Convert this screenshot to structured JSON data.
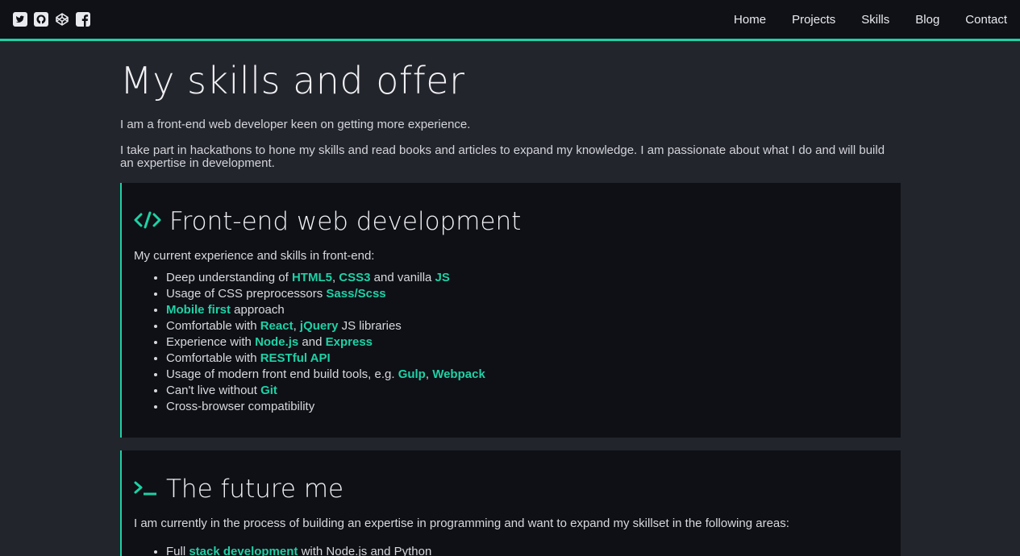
{
  "nav": {
    "social": [
      {
        "name": "twitter-icon"
      },
      {
        "name": "github-icon"
      },
      {
        "name": "codepen-icon"
      },
      {
        "name": "facebook-icon"
      }
    ],
    "links": [
      "Home",
      "Projects",
      "Skills",
      "Blog",
      "Contact"
    ]
  },
  "colors": {
    "accent": "#1fd1a5",
    "background": "#23252d",
    "card": "#0e1016",
    "topbar": "#0f1117"
  },
  "page": {
    "title": "My skills and offer",
    "intro1": "I am a front-end web developer keen on getting more experience.",
    "intro2": "I take part in hackathons to hone my skills and read books and articles to expand my knowledge. I am passionate about what I do and will build an expertise in development."
  },
  "frontend": {
    "icon": "code-icon",
    "title": "Front-end web development",
    "lead": "My current experience and skills in front-end:",
    "items": [
      [
        {
          "t": "Deep understanding of "
        },
        {
          "t": "HTML5",
          "h": true
        },
        {
          "t": ", "
        },
        {
          "t": "CSS3",
          "h": true
        },
        {
          "t": " and vanilla "
        },
        {
          "t": "JS",
          "h": true
        }
      ],
      [
        {
          "t": "Usage of CSS preprocessors "
        },
        {
          "t": "Sass/Scss",
          "h": true
        }
      ],
      [
        {
          "t": "Mobile first",
          "h": true
        },
        {
          "t": " approach"
        }
      ],
      [
        {
          "t": "Comfortable with "
        },
        {
          "t": "React",
          "h": true
        },
        {
          "t": ", "
        },
        {
          "t": "jQuery",
          "h": true
        },
        {
          "t": " JS libraries"
        }
      ],
      [
        {
          "t": "Experience with "
        },
        {
          "t": "Node.js",
          "h": true
        },
        {
          "t": " and "
        },
        {
          "t": "Express",
          "h": true
        }
      ],
      [
        {
          "t": "Comfortable with "
        },
        {
          "t": "RESTful API",
          "h": true
        }
      ],
      [
        {
          "t": "Usage of modern front end build tools, e.g. "
        },
        {
          "t": "Gulp",
          "h": true
        },
        {
          "t": ", "
        },
        {
          "t": "Webpack",
          "h": true
        }
      ],
      [
        {
          "t": "Can't live without "
        },
        {
          "t": "Git",
          "h": true
        }
      ],
      [
        {
          "t": "Cross-browser compatibility"
        }
      ]
    ]
  },
  "future": {
    "icon": "terminal-icon",
    "title": "The future me",
    "lead": "I am currently in the process of building an expertise in programming and want to expand my skillset in the following areas:",
    "items": [
      [
        {
          "t": "Full "
        },
        {
          "t": "stack development",
          "h": true
        },
        {
          "t": " with Node.js and Python"
        }
      ]
    ]
  }
}
